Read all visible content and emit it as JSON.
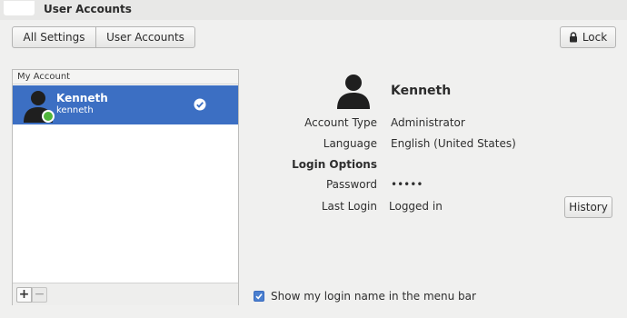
{
  "window": {
    "title": "User Accounts"
  },
  "toolbar": {
    "all_settings_label": "All Settings",
    "user_accounts_label": "User Accounts",
    "lock_label": "Lock"
  },
  "accounts_panel": {
    "header": "My Account",
    "users": [
      {
        "name": "Kenneth",
        "login": "kenneth",
        "online": true,
        "selected": true
      }
    ],
    "add_label": "+",
    "remove_label": "−"
  },
  "details": {
    "name": "Kenneth",
    "account_type_label": "Account Type",
    "account_type_value": "Administrator",
    "language_label": "Language",
    "language_value": "English (United States)",
    "login_options_label": "Login Options",
    "password_label": "Password",
    "password_value": "•••••",
    "last_login_label": "Last Login",
    "last_login_value": "Logged in",
    "history_label": "History"
  },
  "footer": {
    "show_login_name_label": "Show my login name in the menu bar",
    "show_login_name_checked": true
  },
  "colors": {
    "selection": "#3c6fc3",
    "online": "#4fb43a",
    "window_bg": "#f0f0ef"
  }
}
